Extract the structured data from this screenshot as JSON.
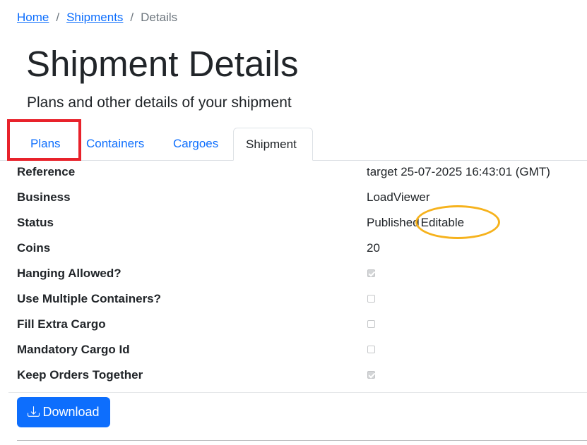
{
  "breadcrumb": {
    "home": "Home",
    "shipments": "Shipments",
    "current": "Details",
    "separator": "/"
  },
  "header": {
    "title": "Shipment Details",
    "subtitle": "Plans and other details of your shipment"
  },
  "tabs": [
    {
      "label": "Plans",
      "active": false
    },
    {
      "label": "Containers",
      "active": false
    },
    {
      "label": "Cargoes",
      "active": false
    },
    {
      "label": "Shipment",
      "active": true
    }
  ],
  "details": {
    "reference": {
      "label": "Reference",
      "value": "target 25-07-2025 16:43:01 (GMT)"
    },
    "business": {
      "label": "Business",
      "value": "LoadViewer"
    },
    "status": {
      "label": "Status",
      "value": "Published",
      "editable_label": "Editable"
    },
    "coins": {
      "label": "Coins",
      "value": "20"
    },
    "hanging_allowed": {
      "label": "Hanging Allowed?",
      "checked": true
    },
    "use_multiple_containers": {
      "label": "Use Multiple Containers?",
      "checked": false
    },
    "fill_extra_cargo": {
      "label": "Fill Extra Cargo",
      "checked": false
    },
    "mandatory_cargo_id": {
      "label": "Mandatory Cargo Id",
      "checked": false
    },
    "keep_orders_together": {
      "label": "Keep Orders Together",
      "checked": true
    }
  },
  "actions": {
    "download_label": "Download",
    "download_icon": "download-icon"
  },
  "colors": {
    "primary": "#0d6efd",
    "highlight_box": "#e8222b",
    "highlight_ellipse": "#f6b21c"
  }
}
